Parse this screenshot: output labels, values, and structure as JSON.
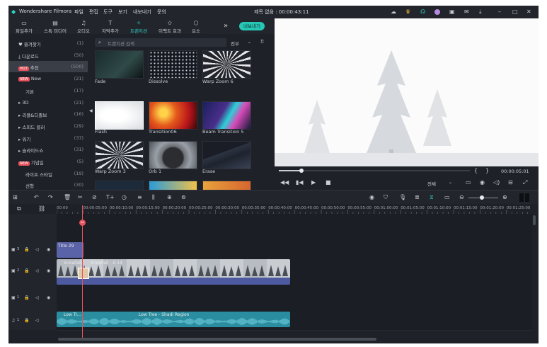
{
  "app_title": "Wondershare Filmora",
  "menu": [
    "파일",
    "편집",
    "도구",
    "보기",
    "내보내기",
    "문의"
  ],
  "project_title": "제목 없음 : 00:00:43:11",
  "toolbar": {
    "tabs": [
      {
        "label": "파일추가",
        "icon": "import-icon"
      },
      {
        "label": "스톡 미디어",
        "icon": "stock-media-icon"
      },
      {
        "label": "오디오",
        "icon": "audio-icon"
      },
      {
        "label": "자막추가",
        "icon": "titles-icon"
      },
      {
        "label": "트랜지션",
        "icon": "transitions-icon",
        "active": true
      },
      {
        "label": "이펙트 효과",
        "icon": "effects-icon"
      },
      {
        "label": "요소",
        "icon": "elements-icon"
      }
    ],
    "more": "»",
    "export_label": "내보내기"
  },
  "sidebar": {
    "items": [
      {
        "label": "즐겨찾기",
        "count": "(1)",
        "icon": "heart-icon"
      },
      {
        "label": "다운로드",
        "count": "(50)",
        "icon": "download-icon"
      },
      {
        "label": "추천",
        "count": "(500)",
        "badge": "HOT",
        "selected": true
      },
      {
        "label": "New",
        "count": "(21)",
        "badge": "NEW"
      },
      {
        "label": "기본",
        "count": "(17)"
      },
      {
        "label": "3D",
        "count": "(21)",
        "arrow": true
      },
      {
        "label": "리플&디졸브",
        "count": "(16)",
        "arrow": true
      },
      {
        "label": "스피드 블러",
        "count": "(29)",
        "arrow": true
      },
      {
        "label": "워기",
        "count": "(37)",
        "arrow": true
      },
      {
        "label": "슬라이드쇼",
        "count": "(31)",
        "arrow": true
      },
      {
        "label": "기념일",
        "count": "(5)",
        "badge": "NEW"
      },
      {
        "label": "라이프 스타일",
        "count": "(19)"
      },
      {
        "label": "선형",
        "count": "(30)"
      }
    ]
  },
  "library": {
    "search_placeholder": "트랜지션 검색",
    "filter_label": "전부",
    "thumbs": [
      {
        "label": "Fade"
      },
      {
        "label": "Dissolve"
      },
      {
        "label": "Warp Zoom 6"
      },
      {
        "label": "Flash"
      },
      {
        "label": "Transition06"
      },
      {
        "label": "Beam Transition 5"
      },
      {
        "label": "Warp Zoom 3"
      },
      {
        "label": "Orb 1"
      },
      {
        "label": "Erase"
      }
    ]
  },
  "player": {
    "progress": 0.12,
    "timecode": "00:00:05:01",
    "quality_label": "전체",
    "bracket_in": "{",
    "bracket_out": "}"
  },
  "timeline": {
    "ruler_ticks": [
      "00:00",
      "00:00:05:00",
      "00:00:10:00",
      "00:00:15:00",
      "00:00:20:00",
      "00:00:25:00",
      "00:00:30:00",
      "00:00:35:00",
      "00:00:40:00",
      "00:00:45:00",
      "00:00:50:00",
      "00:00:55:00",
      "00:01:00:00",
      "00:01:05:00",
      "00:01:10:00",
      "00:01:15:00",
      "00:01:20:00",
      "00:01:25:00"
    ],
    "tracks": [
      {
        "id": "3",
        "type": "video"
      },
      {
        "id": "2",
        "type": "video"
      },
      {
        "id": "1",
        "type": "video"
      },
      {
        "id": "1",
        "type": "audio"
      }
    ],
    "clips": {
      "title_clip": "Title 29",
      "video_clip_a": "Snowfall",
      "video_clip_b": "Snowfall - A 14",
      "audio_clip_a": "Low Tr...",
      "audio_clip_b": "Low Tree - Shadi Region"
    }
  },
  "colors": {
    "accent": "#2fd3c4",
    "playhead": "#e8525c",
    "video_clip": "#5b63a8",
    "audio_clip": "#2a8ea0"
  }
}
